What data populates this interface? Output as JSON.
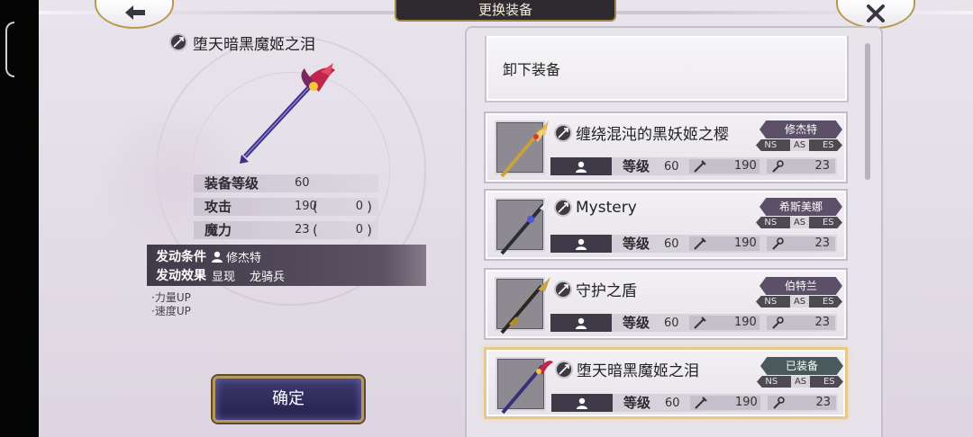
{
  "header": {
    "title": "更换装备",
    "back_icon": "back-arrow-icon",
    "close_icon": "close-x-icon"
  },
  "selected": {
    "name": "堕天暗黑魔姬之泪",
    "stats": [
      {
        "label": "装备等级",
        "value": "60"
      },
      {
        "label": "攻击",
        "value": "190",
        "open": "(",
        "bonus": "0",
        "close": ")"
      },
      {
        "label": "魔力",
        "value": "23",
        "open": "(",
        "bonus": "0",
        "close": ")"
      }
    ],
    "skill": {
      "condition_label": "发动条件",
      "condition_value": "修杰特",
      "effect_label": "发动效果",
      "effect_value": "显现",
      "effect_value2": "龙骑兵"
    },
    "effects": [
      "·力量UP",
      "·速度UP"
    ],
    "confirm_label": "确定"
  },
  "list": {
    "unequip_label": "卸下装备",
    "items": [
      {
        "name": "缠绕混沌的黑妖姬之樱",
        "owner": "修杰特",
        "tags": [
          "NS",
          "AS",
          "ES"
        ],
        "active_tag": "AS",
        "level_label": "等级",
        "level": "60",
        "attack": "190",
        "magic": "23",
        "selected": false,
        "weapon_color": "#c8a23a"
      },
      {
        "name": "Mystery",
        "owner": "希斯美娜",
        "tags": [
          "NS",
          "AS",
          "ES"
        ],
        "active_tag": "AS",
        "level_label": "等级",
        "level": "60",
        "attack": "190",
        "magic": "23",
        "selected": false,
        "weapon_color": "#3c3c44"
      },
      {
        "name": "守护之盾",
        "owner": "伯特兰",
        "tags": [
          "NS",
          "AS",
          "ES"
        ],
        "active_tag": "AS",
        "level_label": "等级",
        "level": "60",
        "attack": "190",
        "magic": "23",
        "selected": false,
        "weapon_color": "#b08d34"
      },
      {
        "name": "堕天暗黑魔姬之泪",
        "owner": "已装备",
        "tags": [
          "NS",
          "AS",
          "ES"
        ],
        "active_tag": "AS",
        "level_label": "等级",
        "level": "60",
        "attack": "190",
        "magic": "23",
        "selected": true,
        "weapon_color": "#3a2f7a"
      }
    ]
  },
  "colors": {
    "accent_gold": "#b6985a",
    "panel_purple": "#403a49",
    "confirm_blue": "#2f2b5e"
  }
}
